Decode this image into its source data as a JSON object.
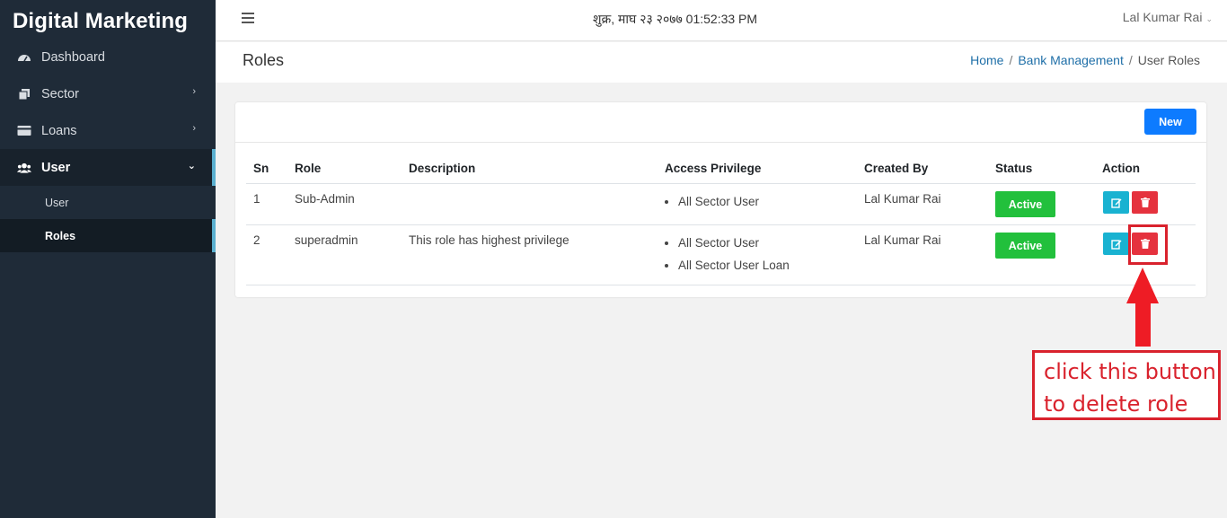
{
  "sidebar": {
    "brand": "Digital Marketing",
    "items": [
      {
        "label": "Dashboard",
        "icon": "dashboard-icon"
      },
      {
        "label": "Sector",
        "icon": "copy-icon"
      },
      {
        "label": "Loans",
        "icon": "card-icon"
      },
      {
        "label": "User",
        "icon": "users-icon"
      }
    ],
    "subitems": [
      {
        "label": "User"
      },
      {
        "label": "Roles"
      }
    ]
  },
  "topbar": {
    "datetime": "शुक्र, माघ २३ २०७७ 01:52:33 PM",
    "username": "Lal Kumar Rai"
  },
  "page": {
    "title": "Roles",
    "breadcrumb": [
      "Home",
      "Bank Management",
      "User Roles"
    ]
  },
  "card": {
    "new_button": "New",
    "columns": [
      "Sn",
      "Role",
      "Description",
      "Access Privilege",
      "Created By",
      "Status",
      "Action"
    ],
    "rows": [
      {
        "sn": "1",
        "role": "Sub-Admin",
        "description": "",
        "privileges": [
          "All Sector User"
        ],
        "created_by": "Lal Kumar Rai",
        "status": "Active"
      },
      {
        "sn": "2",
        "role": "superadmin",
        "description": "This role has highest privilege",
        "privileges": [
          "All Sector User",
          "All Sector User Loan"
        ],
        "created_by": "Lal Kumar Rai",
        "status": "Active"
      }
    ]
  },
  "annotation": {
    "line1": "click this button",
    "line2": "to delete role"
  },
  "colors": {
    "sidebar_bg": "#1f2b38",
    "primary": "#0d7bff",
    "success": "#22c03c",
    "info": "#19b2d1",
    "danger": "#e5323e",
    "annotation": "#d9222d"
  }
}
